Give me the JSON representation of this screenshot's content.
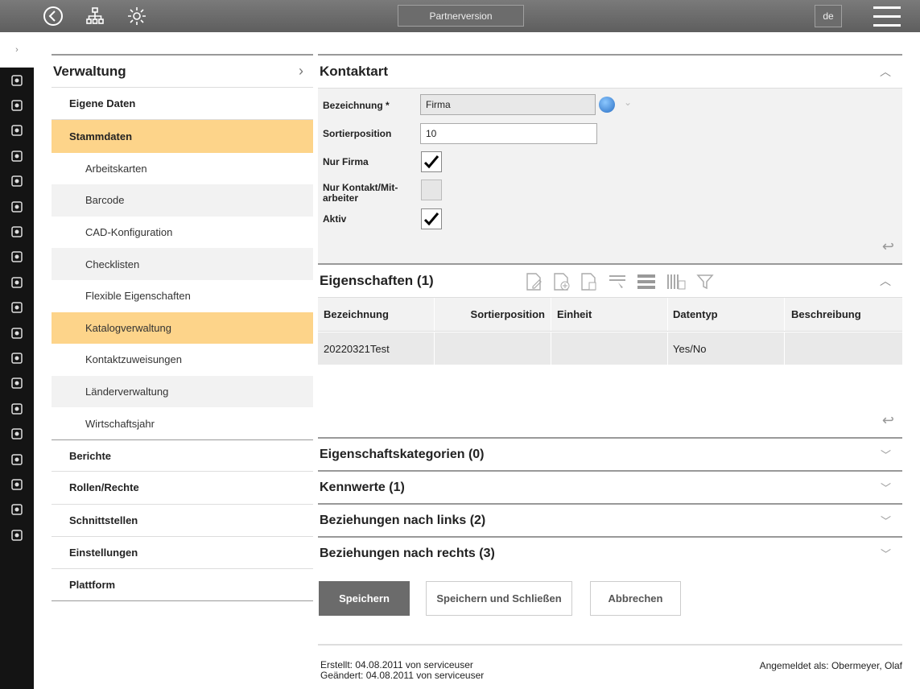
{
  "topbar": {
    "partner_label": "Partnerversion",
    "lang": "de",
    "icons": [
      "back-icon",
      "sitemap-icon",
      "gear-icon",
      "hamburger-menu-icon"
    ]
  },
  "rail": {
    "first": "›",
    "icons": [
      "user-icon",
      "binoculars-icon",
      "chart-icon",
      "tree-icon",
      "box-icon",
      "printer-icon",
      "cart-icon",
      "pen-icon",
      "sitemap-icon",
      "map-icon",
      "calendar-icon",
      "dashboard-icon",
      "car-icon",
      "user-icon",
      "house-icon",
      "cable-icon",
      "map-icon",
      "badge-icon",
      "tools-icon"
    ]
  },
  "nav": {
    "title": "Verwaltung",
    "chevron": "›",
    "items": [
      {
        "label": "Eigene Daten"
      },
      {
        "label": "Stammdaten"
      }
    ],
    "subitems": [
      "Arbeitskarten",
      "Barcode",
      "CAD-Konfiguration",
      "Checklisten",
      "Flexible Eigenschaften",
      "Katalogverwaltung",
      "Kontaktzuweisungen",
      "Länderverwaltung",
      "Wirtschaftsjahr"
    ],
    "bottom_items": [
      "Berichte",
      "Rollen/Rechte",
      "Schnittstellen",
      "Einstellungen",
      "Plattform"
    ]
  },
  "kontaktart": {
    "title": "Kontaktart",
    "bezeichnung_label": "Bezeichnung *",
    "bezeichnung_value": "Firma",
    "sortierposition_label": "Sortierposition",
    "sortierposition_value": "10",
    "nur_firma_label": "Nur Firma",
    "nur_kontakt_label": "Nur Kontakt/Mit-\narbeiter",
    "aktiv_label": "Aktiv",
    "nur_firma_checked": true,
    "nur_kontakt_checked": false,
    "aktiv_checked": true
  },
  "eigenschaften": {
    "title": "Eigenschaften (1)",
    "columns": [
      "Bezeichnung",
      "Sortierposition",
      "Einheit",
      "Datentyp",
      "Beschreibung"
    ],
    "rows": [
      [
        "20220321Test",
        "",
        "",
        "Yes/No",
        ""
      ]
    ]
  },
  "collapsed_sections": [
    "Eigenschaftskategorien (0)",
    "Kennwerte (1)",
    "Beziehungen nach links (2)",
    "Beziehungen nach rechts (3)"
  ],
  "buttons": {
    "save": "Speichern",
    "save_close": "Speichern und Schließen",
    "cancel": "Abbrechen"
  },
  "footer": {
    "created": "Erstellt: 04.08.2011 von serviceuser",
    "changed": "Geändert: 04.08.2011 von serviceuser",
    "logged_in": "Angemeldet als: Obermeyer, Olaf"
  },
  "colors": {
    "highlight": "#fdd48a",
    "topbar": "#6b6b6b",
    "rail": "#141414"
  }
}
